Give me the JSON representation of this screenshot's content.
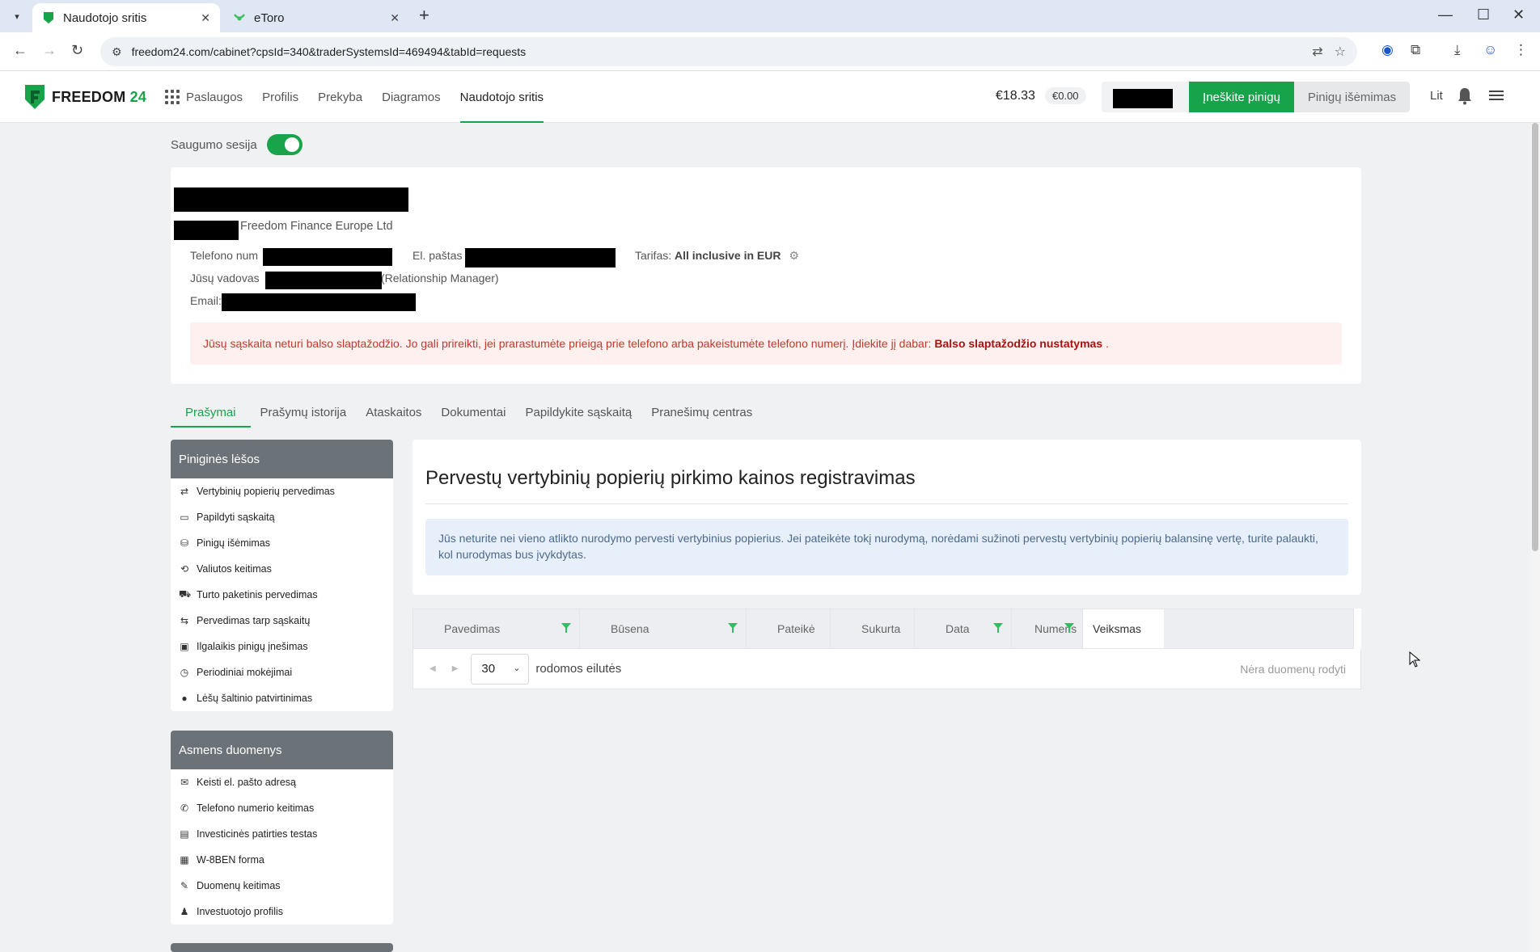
{
  "browser": {
    "tabs": [
      {
        "title": "Naudotojo sritis",
        "active": true
      },
      {
        "title": "eToro",
        "active": false
      }
    ],
    "url": "freedom24.com/cabinet?cpsId=340&traderSystemsId=469494&tabId=requests"
  },
  "header": {
    "brand_main": "FREEDOM",
    "brand_num": "24",
    "nav": [
      "Paslaugos",
      "Profilis",
      "Prekyba",
      "Diagramos",
      "Naudotojo sritis"
    ],
    "balance": "€18.33",
    "balance_secondary": "€0.00",
    "deposit_label": "Įneškite pinigų",
    "withdraw_label": "Pinigų išėmimas",
    "language": "Lit"
  },
  "security_session": {
    "label": "Saugumo sesija",
    "enabled": true
  },
  "profile": {
    "company": "Freedom Finance Europe Ltd",
    "phone_label": "Telefono num",
    "email_label": "El. paštas",
    "tariff_label": "Tarifas:",
    "tariff_value": "All inclusive in EUR",
    "manager_label": "Jūsų vadovas",
    "manager_role": "(Relationship Manager)",
    "manager_email_label": "Email:",
    "alert_text": "Jūsų sąskaita neturi balso slaptažodžio. Jo gali prireikti, jei prarastumėte prieigą prie telefono arba pakeistumėte telefono numerį. Įdiekite jį dabar:",
    "alert_link": "Balso slaptažodžio nustatymas",
    "alert_tail": "."
  },
  "subtabs": [
    "Prašymai",
    "Prašymų istorija",
    "Ataskaitos",
    "Dokumentai",
    "Papildykite sąskaitą",
    "Pranešimų centras"
  ],
  "sidebar": {
    "funds": {
      "title": "Piniginės lėšos",
      "items": [
        {
          "label": "Vertybinių popierių pervedimas",
          "icon": "⇄"
        },
        {
          "label": "Papildyti sąskaitą",
          "icon": "▭"
        },
        {
          "label": "Pinigų išėmimas",
          "icon": "⛁"
        },
        {
          "label": "Valiutos keitimas",
          "icon": "⟲"
        },
        {
          "label": "Turto paketinis pervedimas",
          "icon": "⛟"
        },
        {
          "label": "Pervedimas tarp sąskaitų",
          "icon": "⇆"
        },
        {
          "label": "Ilgalaikis pinigų įnešimas",
          "icon": "▣"
        },
        {
          "label": "Periodiniai mokėjimai",
          "icon": "◷"
        },
        {
          "label": "Lėšų šaltinio patvirtinimas",
          "icon": "●"
        }
      ]
    },
    "personal": {
      "title": "Asmens duomenys",
      "items": [
        {
          "label": "Keisti el. pašto adresą",
          "icon": "✉"
        },
        {
          "label": "Telefono numerio keitimas",
          "icon": "✆"
        },
        {
          "label": "Investicinės patirties testas",
          "icon": "▤"
        },
        {
          "label": "W-8BEN forma",
          "icon": "▦"
        },
        {
          "label": "Duomenų keitimas",
          "icon": "✎"
        },
        {
          "label": "Investuotojo profilis",
          "icon": "♟"
        }
      ]
    }
  },
  "main": {
    "title": "Pervestų vertybinių popierių pirkimo kainos registravimas",
    "info": "Jūs neturite nei vieno atlikto nurodymo pervesti vertybinius popierius. Jei pateikėte tokį nurodymą, norėdami sužinoti pervestų vertybinių popierių balansinę vertę, turite palaukti, kol nurodymas bus įvykdytas."
  },
  "table": {
    "columns": [
      {
        "label": "Pavedimas",
        "filter": true
      },
      {
        "label": "Būsena",
        "filter": true
      },
      {
        "label": "Pateikė",
        "filter": false
      },
      {
        "label": "Sukurta",
        "filter": false
      },
      {
        "label": "Data",
        "filter": true
      },
      {
        "label": "Numeris",
        "filter": true
      },
      {
        "label": "Veiksmas",
        "filter": false
      }
    ],
    "page_size": "30",
    "rows_label": "rodomos eilutės",
    "empty_text": "Nėra duomenų rodyti"
  },
  "colors": {
    "brand_green": "#16a34a",
    "header_gray": "#6b7379",
    "alert_red": "#c0392b"
  }
}
